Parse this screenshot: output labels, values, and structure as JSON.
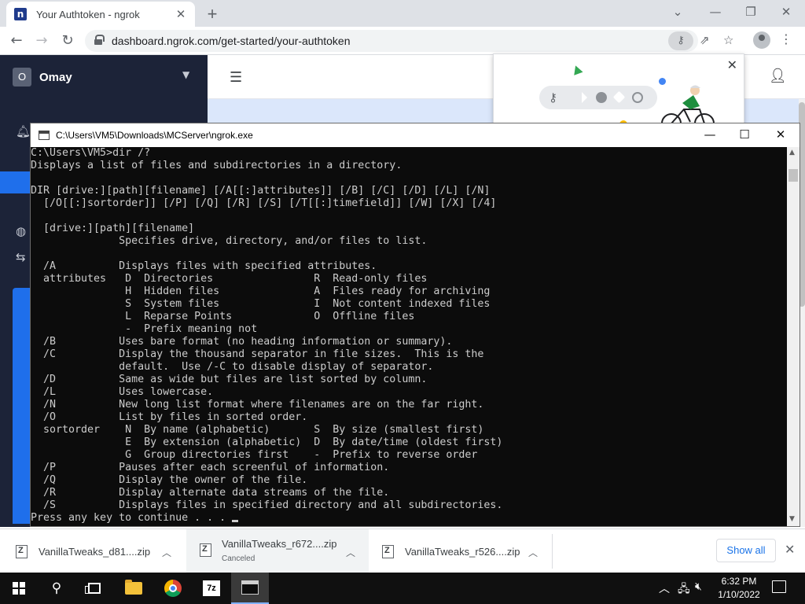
{
  "browser": {
    "tab_favicon": "n",
    "tab_title": "Your Authtoken - ngrok",
    "url": "dashboard.ngrok.com/get-started/your-authtoken",
    "icons": [
      "close-icon",
      "plus-icon",
      "chevron-down-icon",
      "minimize-icon",
      "maximize-icon",
      "back-icon",
      "forward-icon",
      "reload-icon",
      "lock-icon",
      "key-icon",
      "share-icon",
      "star-icon",
      "profile-icon",
      "menu-icon"
    ]
  },
  "dashboard": {
    "account_initial": "O",
    "account_name": "Omay",
    "accent_color": "#1f6feb",
    "sidebar_color": "#1c2338"
  },
  "console": {
    "title": "C:\\Users\\VM5\\Downloads\\MCServer\\ngrok.exe",
    "lines": [
      "C:\\Users\\VM5>dir /?",
      "Displays a list of files and subdirectories in a directory.",
      "",
      "DIR [drive:][path][filename] [/A[[:]attributes]] [/B] [/C] [/D] [/L] [/N]",
      "  [/O[[:]sortorder]] [/P] [/Q] [/R] [/S] [/T[[:]timefield]] [/W] [/X] [/4]",
      "",
      "  [drive:][path][filename]",
      "              Specifies drive, directory, and/or files to list.",
      "",
      "  /A          Displays files with specified attributes.",
      "  attributes   D  Directories                R  Read-only files",
      "               H  Hidden files               A  Files ready for archiving",
      "               S  System files               I  Not content indexed files",
      "               L  Reparse Points             O  Offline files",
      "               -  Prefix meaning not",
      "  /B          Uses bare format (no heading information or summary).",
      "  /C          Display the thousand separator in file sizes.  This is the",
      "              default.  Use /-C to disable display of separator.",
      "  /D          Same as wide but files are list sorted by column.",
      "  /L          Uses lowercase.",
      "  /N          New long list format where filenames are on the far right.",
      "  /O          List by files in sorted order.",
      "  sortorder    N  By name (alphabetic)       S  By size (smallest first)",
      "               E  By extension (alphabetic)  D  By date/time (oldest first)",
      "               G  Group directories first    -  Prefix to reverse order",
      "  /P          Pauses after each screenful of information.",
      "  /Q          Display the owner of the file.",
      "  /R          Display alternate data streams of the file.",
      "  /S          Displays files in specified directory and all subdirectories.",
      "Press any key to continue . . . "
    ]
  },
  "downloads": {
    "items": [
      {
        "name": "VanillaTweaks_d81....zip",
        "status": ""
      },
      {
        "name": "VanillaTweaks_r672....zip",
        "status": "Canceled"
      },
      {
        "name": "VanillaTweaks_r526....zip",
        "status": ""
      }
    ],
    "show_all": "Show all"
  },
  "taskbar": {
    "time": "6:32 PM",
    "date": "1/10/2022",
    "seven_zip_label": "7z"
  }
}
